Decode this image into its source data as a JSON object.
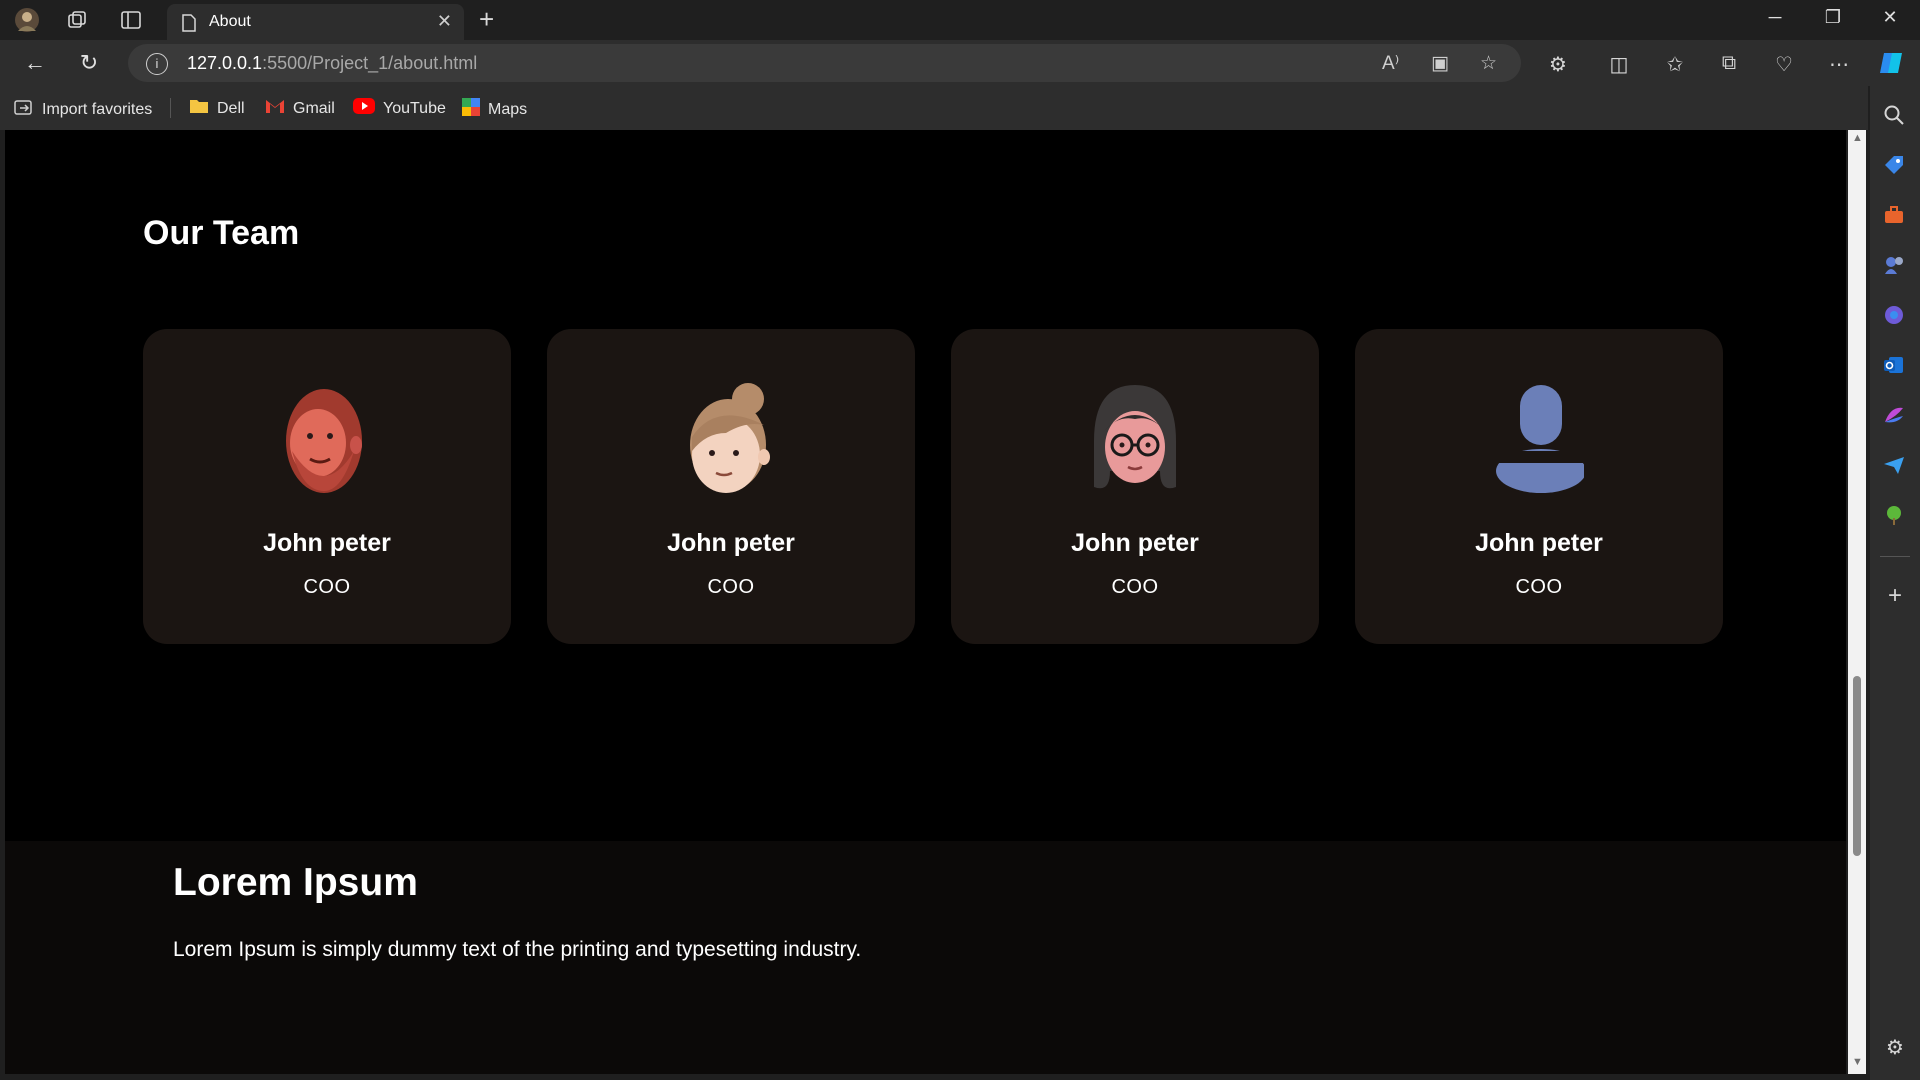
{
  "browser": {
    "tab_title": "About",
    "url_host": "127.0.0.1",
    "url_rest": ":5500/Project_1/about.html"
  },
  "favorites": [
    {
      "label": "Import favorites",
      "icon": "import-favorites-icon"
    },
    {
      "label": "Dell",
      "icon": "folder-icon"
    },
    {
      "label": "Gmail",
      "icon": "gmail-icon"
    },
    {
      "label": "YouTube",
      "icon": "youtube-icon"
    },
    {
      "label": "Maps",
      "icon": "maps-icon"
    }
  ],
  "team": {
    "title": "Our Team",
    "members": [
      {
        "name": "John peter",
        "role": "COO",
        "avatar": "bearded-man-avatar"
      },
      {
        "name": "John peter",
        "role": "COO",
        "avatar": "bun-hair-avatar"
      },
      {
        "name": "John peter",
        "role": "COO",
        "avatar": "glasses-woman-avatar"
      },
      {
        "name": "John peter",
        "role": "COO",
        "avatar": "default-user-avatar"
      }
    ]
  },
  "lorem": {
    "title": "Lorem Ipsum",
    "text": "Lorem Ipsum is simply dummy text of the printing and typesetting industry."
  },
  "colors": {
    "page_bg": "#000000",
    "card_bg": "#1b1512",
    "chrome_bg": "#2d2d2d"
  }
}
